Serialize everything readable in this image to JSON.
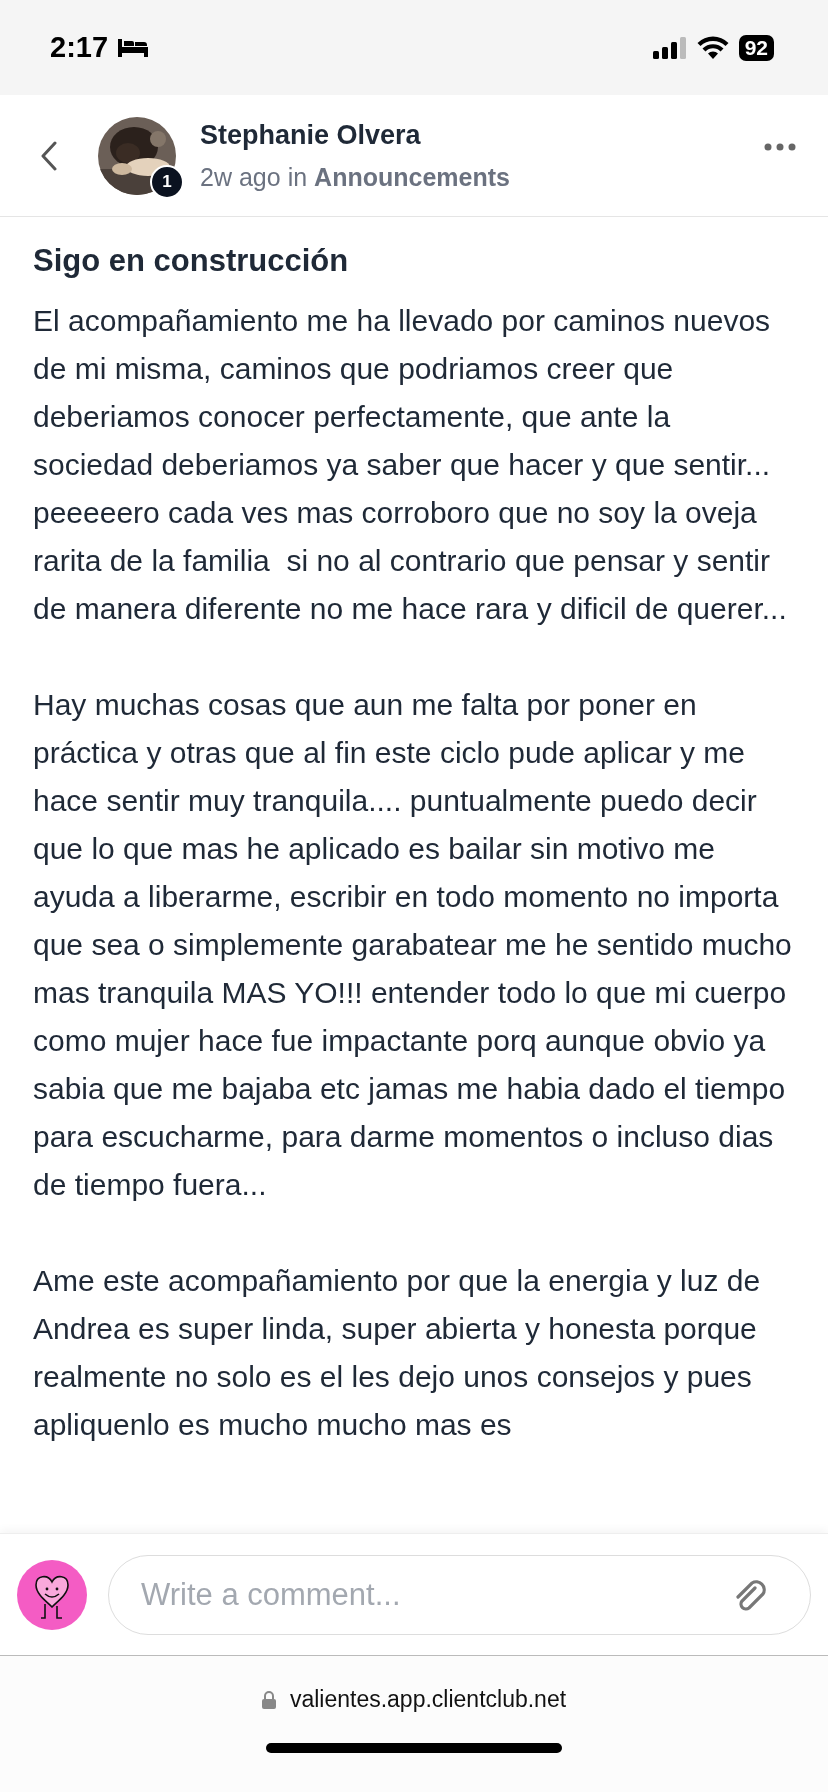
{
  "status_bar": {
    "time": "2:17",
    "battery": "92"
  },
  "post_header": {
    "author": "Stephanie Olvera",
    "badge": "1",
    "time_ago": "2w ago",
    "in_word": "in",
    "space": "Announcements"
  },
  "post": {
    "title": "Sigo en construcción",
    "paragraphs": [
      "El acompañamiento me ha llevado por caminos nuevos de mi misma, caminos que podriamos creer que deberiamos conocer perfectamente, que ante la sociedad deberiamos ya saber que hacer y que sentir... peeeeero cada ves mas corroboro que no soy la oveja rarita de la familia  si no al contrario que pensar y sentir de manera diferente no me hace rara y dificil de querer...",
      "Hay muchas cosas que aun me falta por poner en práctica y otras que al fin este ciclo pude aplicar y me hace sentir muy tranquila.... puntualmente puedo decir que lo que mas he aplicado es bailar sin motivo me ayuda a liberarme, escribir en todo momento no importa que sea o simplemente garabatear me he sentido mucho mas tranquila MAS YO!!! entender todo lo que mi cuerpo como mujer hace fue impactante porq aunque obvio ya sabia que me bajaba etc jamas me habia dado el tiempo para escucharme, para darme momentos o incluso dias de tiempo fuera...",
      "Ame este acompañamiento por que la energia y luz de Andrea es super linda, super abierta y honesta porque realmente no solo es el les dejo unos consejos y pues apliquenlo es mucho mucho mas es"
    ]
  },
  "comment_bar": {
    "placeholder": "Write a comment..."
  },
  "browser": {
    "url": "valientes.app.clientclub.net"
  }
}
